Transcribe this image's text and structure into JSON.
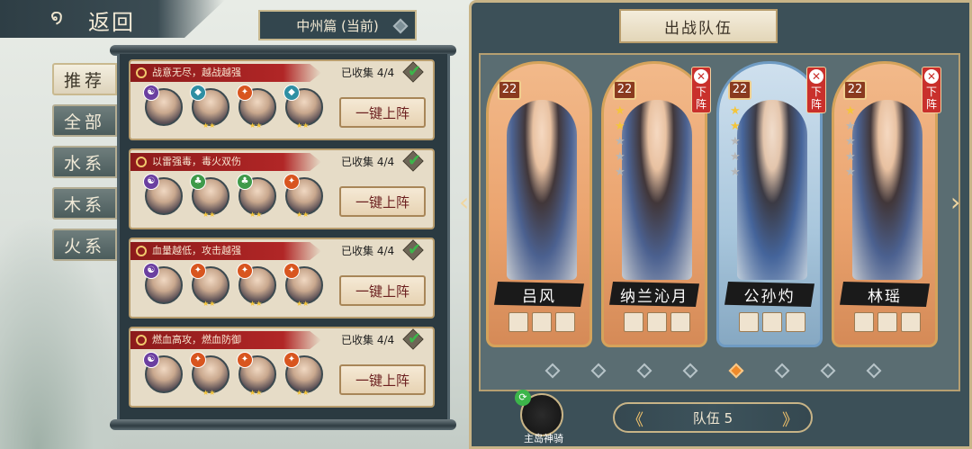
{
  "header": {
    "back_label": "返回",
    "chapter": "中州篇 (当前)"
  },
  "tabs": [
    "推荐",
    "全部",
    "水系",
    "木系",
    "火系"
  ],
  "combos": [
    {
      "title": "战意无尽，越战越强",
      "collected": "已收集 4/4",
      "button": "一键上阵",
      "elements": [
        "yin",
        "water",
        "fire",
        "water"
      ]
    },
    {
      "title": "以雷强毒，毒火双伤",
      "collected": "已收集 4/4",
      "button": "一键上阵",
      "elements": [
        "yin",
        "wood",
        "wood",
        "fire"
      ]
    },
    {
      "title": "血量越低，攻击越强",
      "collected": "已收集 4/4",
      "button": "一键上阵",
      "elements": [
        "yin",
        "fire",
        "fire",
        "fire"
      ]
    },
    {
      "title": "燃血高攻，燃血防御",
      "collected": "已收集 4/4",
      "button": "一键上阵",
      "elements": [
        "yin",
        "fire",
        "fire",
        "fire"
      ]
    }
  ],
  "team": {
    "title": "出战队伍",
    "remove_label": "下阵",
    "cards": [
      {
        "name": "吕风",
        "level": "22",
        "stars": 0,
        "removable": false,
        "selected": false
      },
      {
        "name": "纳兰沁月",
        "level": "22",
        "stars": 2,
        "removable": true,
        "selected": false
      },
      {
        "name": "公孙灼",
        "level": "22",
        "stars": 2,
        "removable": true,
        "selected": true
      },
      {
        "name": "林瑶",
        "level": "22",
        "stars": 1,
        "removable": true,
        "selected": false
      }
    ],
    "page_dots": 8,
    "active_dot": 4,
    "team_label": "队伍 5"
  },
  "skill": {
    "label": "主岛神骑"
  }
}
